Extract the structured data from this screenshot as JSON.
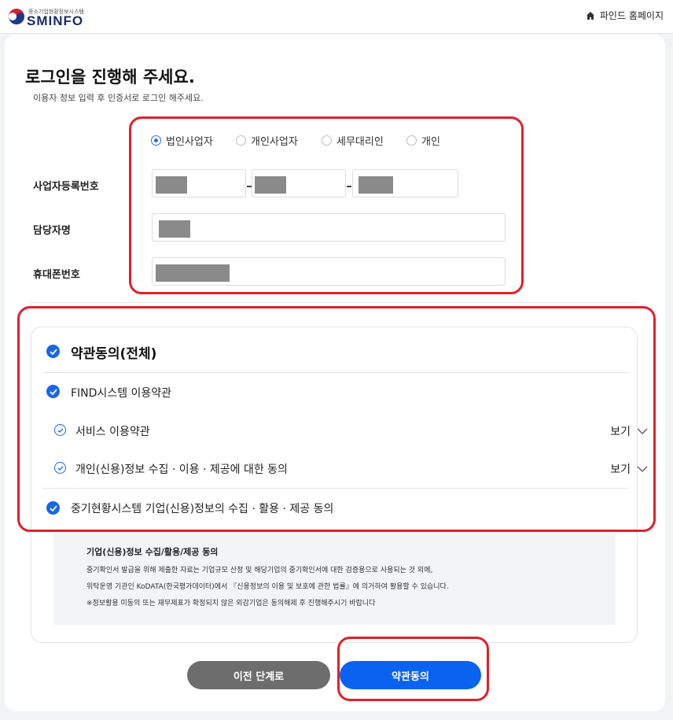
{
  "header": {
    "logo_sub": "중소기업현황정보시스템",
    "logo_text": "SMINFO",
    "home_label": "파인드 홈페이지"
  },
  "main": {
    "title": "로그인을 진행해 주세요.",
    "subtitle": "이용자 정보 입력 후 인증서로 로그인 해주세요."
  },
  "user_types": {
    "selected": "법인사업자",
    "options": [
      "법인사업자",
      "개인사업자",
      "세무대리인",
      "개인"
    ]
  },
  "fields": {
    "biz_reg_label": "사업자등록번호",
    "manager_label": "담당자명",
    "phone_label": "휴대폰번호"
  },
  "terms": {
    "all": "약관동의(전체)",
    "find_system": "FIND시스템 이용약관",
    "service": "서비스 이용약관",
    "personal_info": "개인(신용)정보 수집 · 이용 · 제공에 대한 동의",
    "corp_info": "중기현황시스템 기업(신용)정보의 수집 · 활용 · 제공 동의",
    "view_label": "보기"
  },
  "info": {
    "title": "기업(신용)정보 수집/활용/제공 동의",
    "line1": "중기확인서 발급을 위해 제출한 자료는 기업규모 산정 및 해당기업의 중기확인서에 대한 검증용으로 사용되는 것 외에,",
    "line2": "위탁운영 기관인 KoDATA(한국평가데이터)에서 『신용정보의 이용 및 보호에 관한 법률』에 의거하여 활용할 수 있습니다.",
    "line3": "※정보활용 미동의 또는 재무제표가 확정되지 않은 외감기업은 동의해제 후 진행해주시기 바랍니다"
  },
  "buttons": {
    "prev": "이전 단계로",
    "agree": "약관동의"
  },
  "colors": {
    "accent": "#0a62f0",
    "highlight": "#e0202a",
    "prev_button": "#6d6d6d",
    "logo": "#1b2a6b"
  }
}
